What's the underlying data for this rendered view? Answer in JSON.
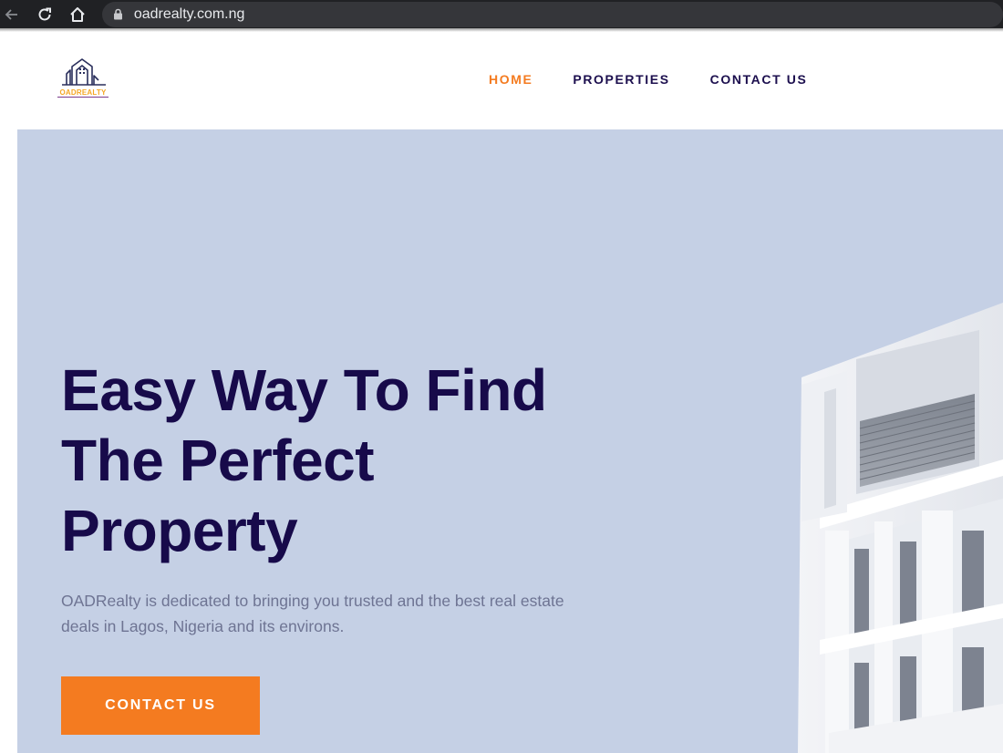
{
  "browser": {
    "url": "oadrealty.com.ng",
    "icons": [
      "back-arrow-icon",
      "reload-icon",
      "home-icon",
      "lock-icon"
    ]
  },
  "header": {
    "logo_text": "OADREALTY",
    "nav": [
      {
        "label": "HOME",
        "active": true
      },
      {
        "label": "PROPERTIES",
        "active": false
      },
      {
        "label": "CONTACT US",
        "active": false
      }
    ]
  },
  "hero": {
    "title_lines": [
      "Easy Way To Find",
      "The Perfect",
      "Property"
    ],
    "subtitle": "OADRealty is dedicated to bringing you trusted and the best real estate deals in Lagos, Nigeria and its environs.",
    "cta_label": "CONTACT US"
  },
  "colors": {
    "accent": "#f47b20",
    "nav_text": "#1c0f4e",
    "hero_bg": "#c5d0e5",
    "title": "#170a4a",
    "subtitle": "#6e7493",
    "browser_bg": "#202124"
  }
}
